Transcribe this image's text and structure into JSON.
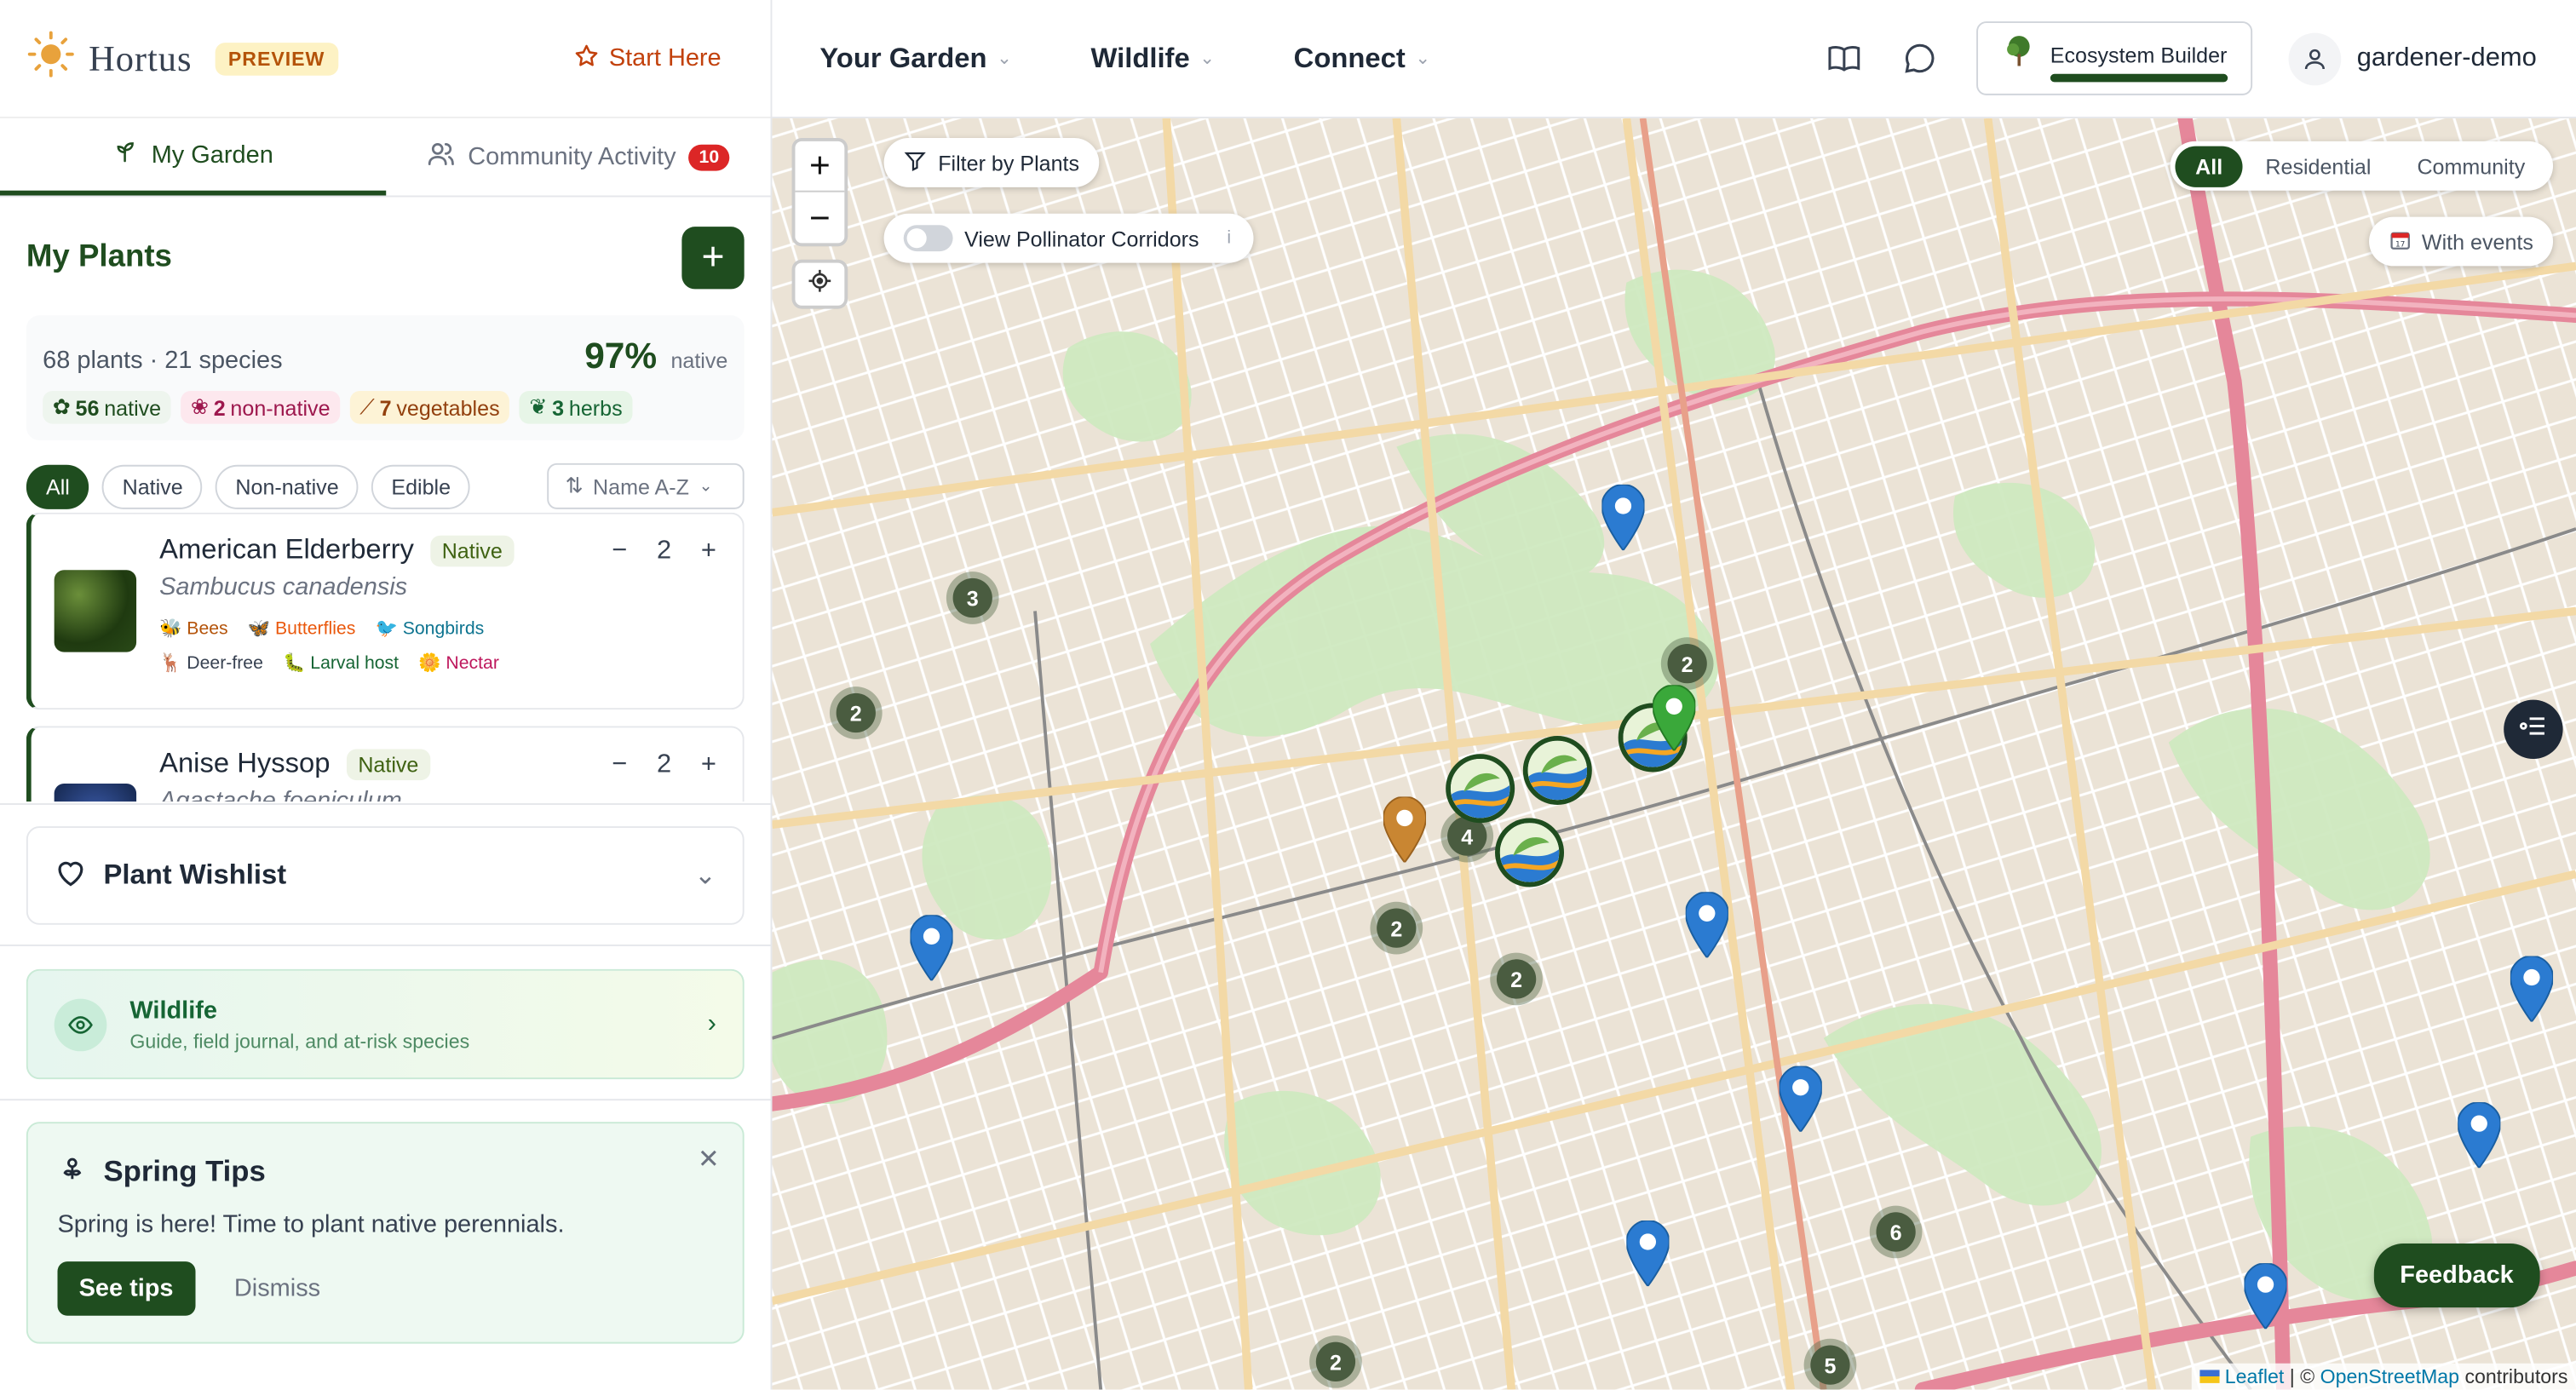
{
  "brand": {
    "name": "Hortus",
    "badge": "PREVIEW",
    "start_here": "Start Here"
  },
  "side_tabs": {
    "my_garden": "My Garden",
    "community": "Community Activity",
    "community_count": "10"
  },
  "my_plants": {
    "title": "My Plants",
    "summary": "68 plants · 21 species",
    "native_pct": "97%",
    "native_word": "native",
    "pills": {
      "native_n": "56",
      "native_l": "native",
      "nonnative_n": "2",
      "nonnative_l": "non-native",
      "veg_n": "7",
      "veg_l": "vegetables",
      "herb_n": "3",
      "herb_l": "herbs"
    },
    "filters": [
      "All",
      "Native",
      "Non-native",
      "Edible"
    ],
    "sort": "Name A-Z"
  },
  "plants": [
    {
      "name": "American Elderberry",
      "tag": "Native",
      "sci": "Sambucus canadensis",
      "qty": "2",
      "attrs1": [
        "Bees",
        "Butterflies",
        "Songbirds"
      ],
      "attrs2": [
        "Deer-free",
        "Larval host",
        "Nectar"
      ]
    },
    {
      "name": "Anise Hyssop",
      "tag": "Native",
      "sci": "Agastache foeniculum",
      "qty": "2"
    }
  ],
  "wishlist": {
    "title": "Plant Wishlist"
  },
  "wildlife": {
    "title": "Wildlife",
    "subtitle": "Guide, field journal, and at-risk species"
  },
  "tips": {
    "title": "Spring Tips",
    "body": "Spring is here! Time to plant native perennials.",
    "cta": "See tips",
    "dismiss": "Dismiss"
  },
  "nav": {
    "items": [
      "Your Garden",
      "Wildlife",
      "Connect"
    ],
    "eco": "Ecosystem Builder",
    "user": "gardener-demo"
  },
  "map": {
    "filter_label": "Filter by Plants",
    "corridors_label": "View Pollinator Corridors",
    "segments": [
      "All",
      "Residential",
      "Community"
    ],
    "events_label": "With events",
    "feedback": "Feedback",
    "attribution": {
      "leaflet": "Leaflet",
      "sep": " | © ",
      "osm": "OpenStreetMap",
      "rest": " contributors"
    },
    "clusters": [
      "3",
      "2",
      "2",
      "4",
      "2",
      "2",
      "6",
      "2",
      "5"
    ]
  },
  "colors": {
    "brand_green": "#1f4d1f",
    "accent_orange": "#c2410c",
    "badge_red": "#dc2626",
    "marker_blue": "#2b7bd1"
  }
}
